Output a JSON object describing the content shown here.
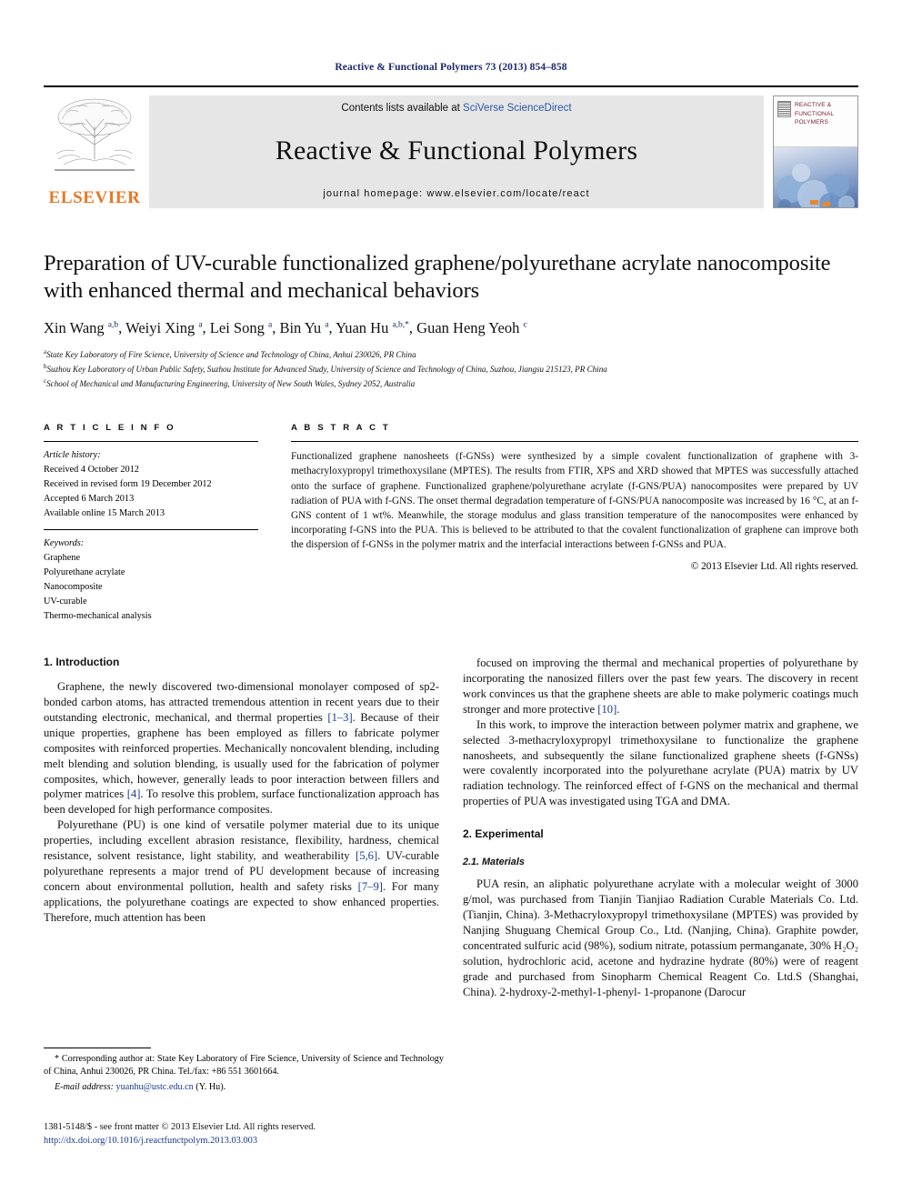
{
  "running_head": "Reactive & Functional Polymers 73 (2013) 854–858",
  "masthead": {
    "publisher_word": "ELSEVIER",
    "publisher_logo_name": "elsevier-tree-logo",
    "contents_prefix": "Contents lists available at ",
    "contents_link": "SciVerse ScienceDirect",
    "journal_name": "Reactive & Functional Polymers",
    "homepage": "journal homepage: www.elsevier.com/locate/react",
    "cover_title": "REACTIVE &\nFUNCTIONAL\nPOLYMERS",
    "cover_title_lines": [
      "REACTIVE &",
      "FUNCTIONAL",
      "POLYMERS"
    ]
  },
  "article": {
    "title": "Preparation of UV-curable functionalized graphene/polyurethane acrylate nanocomposite with enhanced thermal and mechanical behaviors",
    "authors_html": "Xin Wang <sup>a,b</sup>, Weiyi Xing <sup>a</sup>, Lei Song <sup>a</sup>, Bin Yu <sup>a</sup>, Yuan Hu <sup>a,b,</sup><sup>*</sup>, Guan Heng Yeoh <sup>c</sup>",
    "affiliations": [
      {
        "marker": "a",
        "text": "State Key Laboratory of Fire Science, University of Science and Technology of China, Anhui 230026, PR China"
      },
      {
        "marker": "b",
        "text": "Suzhou Key Laboratory of Urban Public Safety, Suzhou Institute for Advanced Study, University of Science and Technology of China, Suzhou, Jiangsu 215123, PR China"
      },
      {
        "marker": "c",
        "text": "School of Mechanical and Manufacturing Engineering, University of New South Wales, Sydney 2052, Australia"
      }
    ]
  },
  "article_info": {
    "heading": "A R T I C L E   I N F O",
    "history_label": "Article history:",
    "history": [
      "Received 4 October 2012",
      "Received in revised form 19 December 2012",
      "Accepted 6 March 2013",
      "Available online 15 March 2013"
    ],
    "keywords_label": "Keywords:",
    "keywords": [
      "Graphene",
      "Polyurethane acrylate",
      "Nanocomposite",
      "UV-curable",
      "Thermo-mechanical analysis"
    ]
  },
  "abstract": {
    "heading": "A B S T R A C T",
    "text": "Functionalized graphene nanosheets (f-GNSs) were synthesized by a simple covalent functionalization of graphene with 3-methacryloxypropyl trimethoxysilane (MPTES). The results from FTIR, XPS and XRD showed that MPTES was successfully attached onto the surface of graphene. Functionalized graphene/polyurethane acrylate (f-GNS/PUA) nanocomposites were prepared by UV radiation of PUA with f-GNS. The onset thermal degradation temperature of f-GNS/PUA nanocomposite was increased by 16 °C, at an f-GNS content of 1 wt%. Meanwhile, the storage modulus and glass transition temperature of the nanocomposites were enhanced by incorporating f-GNS into the PUA. This is believed to be attributed to that the covalent functionalization of graphene can improve both the dispersion of f-GNSs in the polymer matrix and the interfacial interactions between f-GNSs and PUA.",
    "copyright": "© 2013 Elsevier Ltd. All rights reserved."
  },
  "sections": {
    "introduction_heading": "1. Introduction",
    "experimental_heading": "2. Experimental",
    "materials_heading": "2.1. Materials"
  },
  "body": {
    "left": [
      "Graphene, the newly discovered two-dimensional monolayer composed of sp2-bonded carbon atoms, has attracted tremendous attention in recent years due to their outstanding electronic, mechanical, and thermal properties [1–3]. Because of their unique properties, graphene has been employed as fillers to fabricate polymer composites with reinforced properties. Mechanically noncovalent blending, including melt blending and solution blending, is usually used for the fabrication of polymer composites, which, however, generally leads to poor interaction between fillers and polymer matrices [4]. To resolve this problem, surface functionalization approach has been developed for high performance composites.",
      "Polyurethane (PU) is one kind of versatile polymer material due to its unique properties, including excellent abrasion resistance, flexibility, hardness, chemical resistance, solvent resistance, light stability, and weatherability [5,6]. UV-curable polyurethane represents a major trend of PU development because of increasing concern about environmental pollution, health and safety risks [7–9]. For many applications, the polyurethane coatings are expected to show enhanced properties. Therefore, much attention has been"
    ],
    "right": [
      "focused on improving the thermal and mechanical properties of polyurethane by incorporating the nanosized fillers over the past few years. The discovery in recent work convinces us that the graphene sheets are able to make polymeric coatings much stronger and more protective [10].",
      "In this work, to improve the interaction between polymer matrix and graphene, we selected 3-methacryloxypropyl trimethoxysilane to functionalize the graphene nanosheets, and subsequently the silane functionalized graphene sheets (f-GNSs) were covalently incorporated into the polyurethane acrylate (PUA) matrix by UV radiation technology. The reinforced effect of f-GNS on the mechanical and thermal properties of PUA was investigated using TGA and DMA."
    ],
    "materials_para": "PUA resin, an aliphatic polyurethane acrylate with a molecular weight of 3000 g/mol, was purchased from Tianjin Tianjiao Radiation Curable Materials Co. Ltd. (Tianjin, China). 3-Methacryloxypropyl trimethoxysilane (MPTES) was provided by Nanjing Shuguang Chemical Group Co., Ltd. (Nanjing, China). Graphite powder, concentrated sulfuric acid (98%), sodium nitrate, potassium permanganate, 30% H₂O₂ solution, hydrochloric acid, acetone and hydrazine hydrate (80%) were of reagent grade and purchased from Sinopharm Chemical Reagent Co. Ltd.S (Shanghai, China). 2-hydroxy-2-methyl-1-phenyl- 1-propanone (Darocur"
  },
  "footnote": {
    "corresponding": "* Corresponding author at: State Key Laboratory of Fire Science, University of Science and Technology of China, Anhui 230026, PR China. Tel./fax: +86 551 3601664.",
    "email_label": "E-mail address:",
    "email": "yuanhu@ustc.edu.cn",
    "email_suffix": "(Y. Hu)."
  },
  "footer": {
    "issn": "1381-5148/$ - see front matter © 2013 Elsevier Ltd. All rights reserved.",
    "doi": "http://dx.doi.org/10.1016/j.reactfunctpolym.2013.03.003"
  },
  "colors": {
    "link": "#1a3a8f",
    "running_head": "#1a2a6c",
    "elsevier_orange": "#E87722",
    "sciencedirect_blue": "#2b57a8",
    "band_gray": "#e6e6e6"
  }
}
